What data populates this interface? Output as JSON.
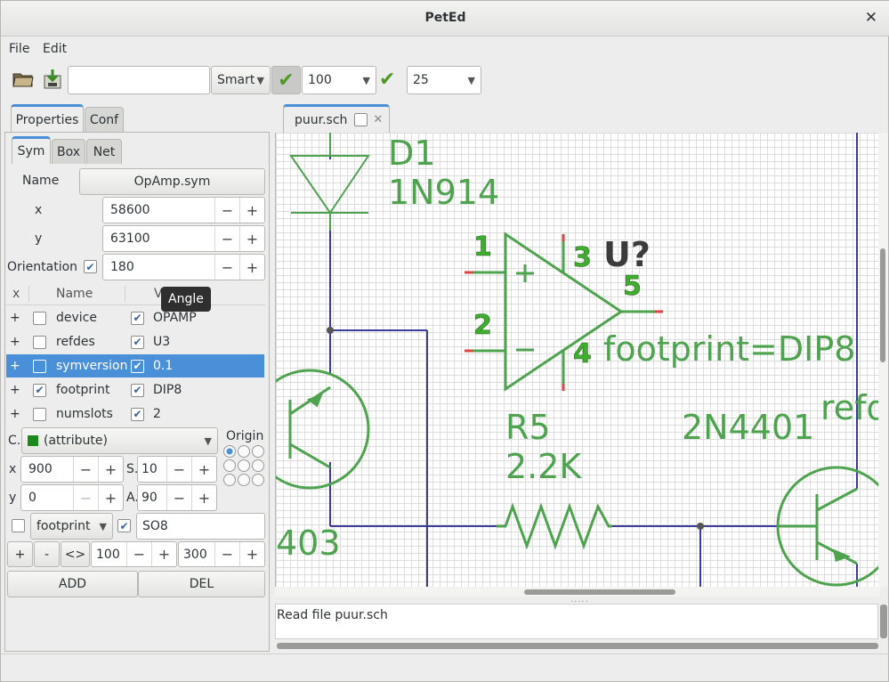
{
  "window": {
    "title": "PetEd"
  },
  "menu": {
    "file": "File",
    "edit": "Edit"
  },
  "toolbar": {
    "search_value": "",
    "mode": "Smart",
    "zoom": "100",
    "grid": "25"
  },
  "left_tabs": {
    "properties": "Properties",
    "conf": "Conf"
  },
  "sub_tabs": {
    "sym": "Sym",
    "box": "Box",
    "net": "Net"
  },
  "sym": {
    "name_label": "Name",
    "name_value": "OpAmp.sym",
    "x_label": "x",
    "x_value": "58600",
    "y_label": "y",
    "y_value": "63100",
    "orientation_label": "Orientation",
    "orientation_value": "180"
  },
  "attr_table": {
    "headers": {
      "x": "x",
      "name": "Name",
      "value": "V"
    },
    "rows": [
      {
        "expand": "+",
        "name": "device",
        "value": "OPAMP",
        "visible": false,
        "show_value": true
      },
      {
        "expand": "+",
        "name": "refdes",
        "value": "U3",
        "visible": false,
        "show_value": true
      },
      {
        "expand": "+",
        "name": "symversion",
        "value": "0.1",
        "visible": false,
        "show_value": true
      },
      {
        "expand": "+",
        "name": "footprint",
        "value": "DIP8",
        "visible": true,
        "show_value": true
      },
      {
        "expand": "+",
        "name": "numslots",
        "value": "2",
        "visible": false,
        "show_value": true
      }
    ]
  },
  "tooltip": "Angle",
  "attr_edit": {
    "color_label": "C.",
    "color_value": "(attribute)",
    "color_swatch": "#1a8a1a",
    "origin_label": "Origin",
    "x_label": "x",
    "x_value": "900",
    "size_label": "S.",
    "size_value": "10",
    "y_label": "y",
    "y_value": "0",
    "angle_label": "A.",
    "angle_value": "90",
    "attr_name": "footprint",
    "attr_value": "SO8"
  },
  "bottom_row": {
    "plus": "+",
    "minus": "-",
    "swap": "<>",
    "w_value": "100",
    "h_value": "300",
    "add": "ADD",
    "del": "DEL"
  },
  "document_tab": {
    "label": "puur.sch"
  },
  "schematic": {
    "d1_ref": "D1",
    "d1_val": "1N914",
    "u_ref": "U?",
    "pin1": "1",
    "pin2": "2",
    "pin3": "3",
    "pin4": "4",
    "pin5": "5",
    "footprint_attr": "footprint=DIP8",
    "r5_ref": "R5",
    "r5_val": "2.2K",
    "q_val": "2N4401",
    "refdes_partial": "refd",
    "q_left_partial": "403",
    "net_color": "#3c3c9a",
    "symbol_color": "#4ea34e"
  },
  "status": {
    "message": "Read file puur.sch"
  }
}
